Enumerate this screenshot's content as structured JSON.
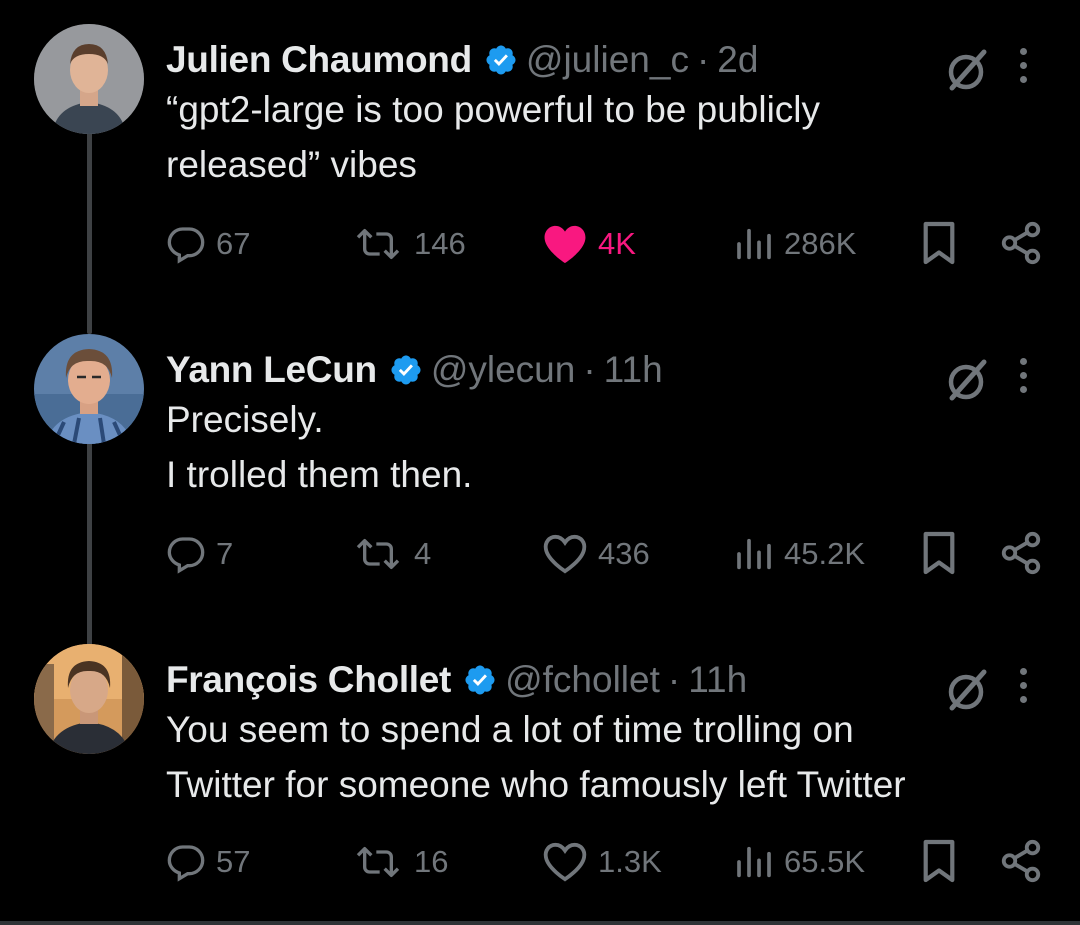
{
  "colors": {
    "background": "#000000",
    "text": "#e7e9ea",
    "muted": "#71767b",
    "verified": "#1d9bf0",
    "like": "#f91880"
  },
  "tweets": [
    {
      "name": "Julien Chaumond",
      "handle": "@julien_c",
      "separator": "·",
      "time": "2d",
      "lines": [
        "“gpt2-large is too powerful to be publicly",
        "released” vibes"
      ],
      "replies": "67",
      "retweets": "146",
      "likes": "4K",
      "liked": true,
      "views": "286K"
    },
    {
      "name": "Yann LeCun",
      "handle": "@ylecun",
      "separator": "·",
      "time": "11h",
      "lines": [
        "Precisely.",
        "I trolled them then."
      ],
      "replies": "7",
      "retweets": "4",
      "likes": "436",
      "liked": false,
      "views": "45.2K"
    },
    {
      "name": "François Chollet",
      "handle": "@fchollet",
      "separator": "·",
      "time": "11h",
      "lines": [
        "You seem to spend a lot of time trolling on",
        "Twitter for someone who famously left Twitter"
      ],
      "replies": "57",
      "retweets": "16",
      "likes": "1.3K",
      "liked": false,
      "views": "65.5K"
    }
  ],
  "icons": {
    "verified": "verified-badge-icon",
    "grok": "grok-icon",
    "more": "more-icon",
    "reply": "reply-icon",
    "retweet": "retweet-icon",
    "like": "heart-icon",
    "views": "views-icon",
    "bookmark": "bookmark-icon",
    "share": "share-icon"
  }
}
